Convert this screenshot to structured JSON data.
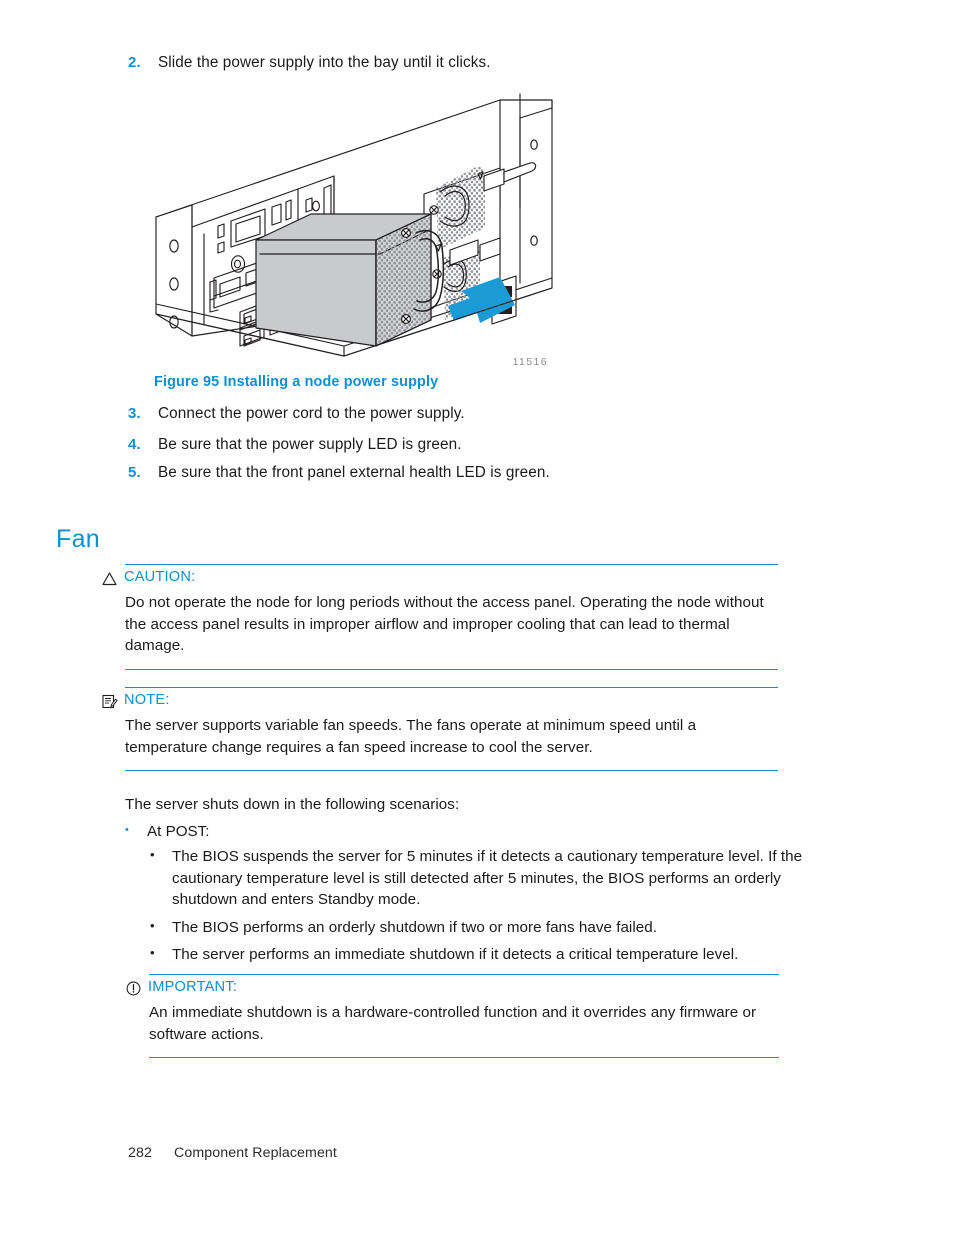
{
  "steps_top": [
    {
      "num": "2.",
      "text": "Slide the power supply into the bay until it clicks."
    }
  ],
  "figure": {
    "id_label": "11516",
    "caption": "Figure 95 Installing a node power supply",
    "alt_desc": "Line drawing of a server rear panel with a node power supply being slid into its bay; a blue arrow indicates the insertion direction."
  },
  "steps_after_figure": [
    {
      "num": "3.",
      "text": "Connect the power cord to the power supply."
    },
    {
      "num": "4.",
      "text": "Be sure that the power supply LED is green."
    },
    {
      "num": "5.",
      "text": "Be sure that the front panel external health LED is green."
    }
  ],
  "section": {
    "heading": "Fan"
  },
  "caution": {
    "icon": "warning-triangle-icon",
    "label": "CAUTION:",
    "body": "Do not operate the node for long periods without the access panel. Operating the node without the access panel results in improper airflow and improper cooling that can lead to thermal damage."
  },
  "note": {
    "icon": "note-pencil-icon",
    "label": "NOTE:",
    "body": "The server supports variable fan speeds. The fans operate at minimum speed until a temperature change requires a fan speed increase to cool the server."
  },
  "intro_paragraph": "The server shuts down in the following scenarios:",
  "scenario_list": {
    "bullet_char": "•",
    "item_label": "At POST:",
    "subitems": [
      "The BIOS suspends the server for 5 minutes if it detects a cautionary temperature level. If the cautionary temperature level is still detected after 5 minutes, the BIOS performs an orderly shutdown and enters Standby mode.",
      "The BIOS performs an orderly shutdown if two or more fans have failed.",
      "The server performs an immediate shutdown if it detects a critical temperature level."
    ]
  },
  "important": {
    "icon": "exclamation-circle-icon",
    "label": "IMPORTANT:",
    "body": "An immediate shutdown is a hardware-controlled function and it overrides any firmware or software actions."
  },
  "footer": {
    "page_number": "282",
    "chapter_title": "Component Replacement"
  },
  "colors": {
    "accent_blue": "#0d8fd1",
    "body_text": "#1b1b1b",
    "figure_id_gray": "#8a8a8a",
    "illustration_line": "#231f20",
    "illustration_fill": "#c9cacc",
    "arrow_blue": "#1b9ad6"
  }
}
